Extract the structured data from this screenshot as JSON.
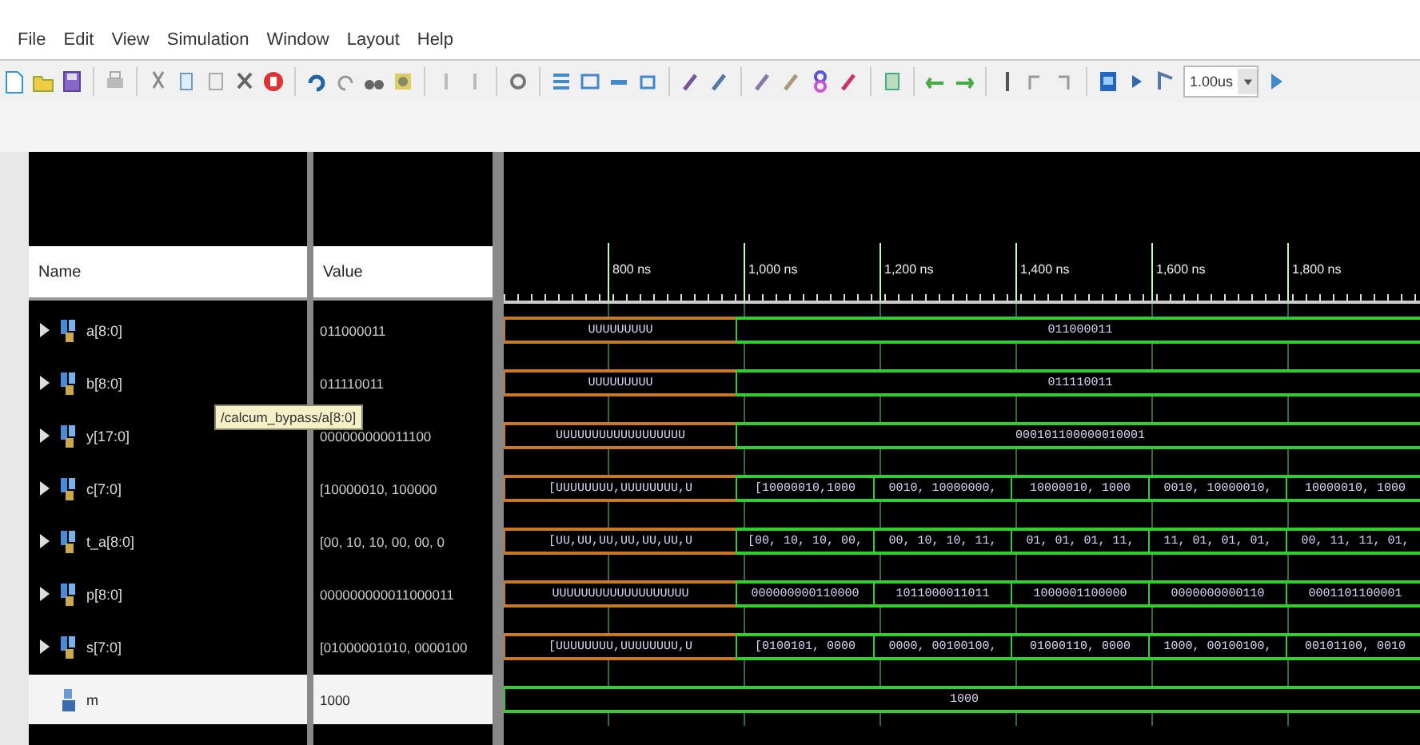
{
  "menu": [
    "File",
    "Edit",
    "View",
    "Simulation",
    "Window",
    "Layout",
    "Help"
  ],
  "toolbar": {
    "run_time": "1.00us"
  },
  "columns": {
    "name": "Name",
    "value": "Value"
  },
  "ruler": [
    "800 ns",
    "1,000 ns",
    "1,200 ns",
    "1,400 ns",
    "1,600 ns",
    "1,800 ns"
  ],
  "signals": [
    {
      "name": "a[8:0]",
      "value": "011000011",
      "kind": "bus",
      "expandable": true,
      "selected": false,
      "segments": [
        {
          "kind": "undefined",
          "text": "UUUUUUUUU"
        },
        {
          "kind": "valid",
          "text": "011000011"
        }
      ]
    },
    {
      "name": "b[8:0]",
      "value": "011110011",
      "kind": "bus",
      "expandable": true,
      "selected": false,
      "segments": [
        {
          "kind": "undefined",
          "text": "UUUUUUUUU"
        },
        {
          "kind": "valid",
          "text": "011110011"
        }
      ]
    },
    {
      "name": "y[17:0]",
      "value": "000000000011100",
      "kind": "bus",
      "expandable": true,
      "selected": false,
      "segments": [
        {
          "kind": "undefined",
          "text": "UUUUUUUUUUUUUUUUUU"
        },
        {
          "kind": "valid",
          "text": "000101100000010001"
        }
      ]
    },
    {
      "name": "c[7:0]",
      "value": "[10000010, 100000",
      "kind": "bus",
      "expandable": true,
      "selected": false,
      "segments": [
        {
          "kind": "undefined",
          "text": "[UUUUUUUU,UUUUUUUU,U"
        },
        {
          "kind": "valid",
          "text": "[10000010,1000"
        },
        {
          "kind": "valid",
          "text": "0010, 10000000,"
        },
        {
          "kind": "valid",
          "text": "10000010, 1000"
        },
        {
          "kind": "valid",
          "text": "0010, 10000010,"
        },
        {
          "kind": "valid",
          "text": "10000010, 1000"
        }
      ]
    },
    {
      "name": "t_a[8:0]",
      "value": "[00, 10, 10, 00, 00, 0",
      "kind": "bus",
      "expandable": true,
      "selected": false,
      "segments": [
        {
          "kind": "undefined",
          "text": "[UU,UU,UU,UU,UU,UU,U"
        },
        {
          "kind": "valid",
          "text": "[00, 10, 10, 00,"
        },
        {
          "kind": "valid",
          "text": "00, 10, 10, 11,"
        },
        {
          "kind": "valid",
          "text": "01, 01, 01, 11,"
        },
        {
          "kind": "valid",
          "text": "11, 01, 01, 01,"
        },
        {
          "kind": "valid",
          "text": "00, 11, 11, 01,"
        }
      ]
    },
    {
      "name": "p[8:0]",
      "value": "000000000011000011",
      "kind": "bus",
      "expandable": true,
      "selected": false,
      "segments": [
        {
          "kind": "undefined",
          "text": "UUUUUUUUUUUUUUUUUUU"
        },
        {
          "kind": "valid",
          "text": "000000000110000"
        },
        {
          "kind": "valid",
          "text": "1011000011011"
        },
        {
          "kind": "valid",
          "text": "1000001100000"
        },
        {
          "kind": "valid",
          "text": "0000000000110"
        },
        {
          "kind": "valid",
          "text": "0001101100001"
        }
      ]
    },
    {
      "name": "s[7:0]",
      "value": "[01000001010, 0000100",
      "kind": "bus",
      "expandable": true,
      "selected": false,
      "segments": [
        {
          "kind": "undefined",
          "text": "[UUUUUUUU,UUUUUUUU,U"
        },
        {
          "kind": "valid",
          "text": "[0100101, 0000"
        },
        {
          "kind": "valid",
          "text": "0000, 00100100,"
        },
        {
          "kind": "valid",
          "text": "01000110, 0000"
        },
        {
          "kind": "valid",
          "text": "1000, 00100100,"
        },
        {
          "kind": "valid",
          "text": "00101100, 0010"
        }
      ]
    },
    {
      "name": "m",
      "value": "1000",
      "kind": "signal",
      "expandable": false,
      "selected": true,
      "segments": [
        {
          "kind": "valid",
          "text": "1000"
        }
      ]
    }
  ],
  "tooltip": "/calcum_bypass/a[8:0]"
}
